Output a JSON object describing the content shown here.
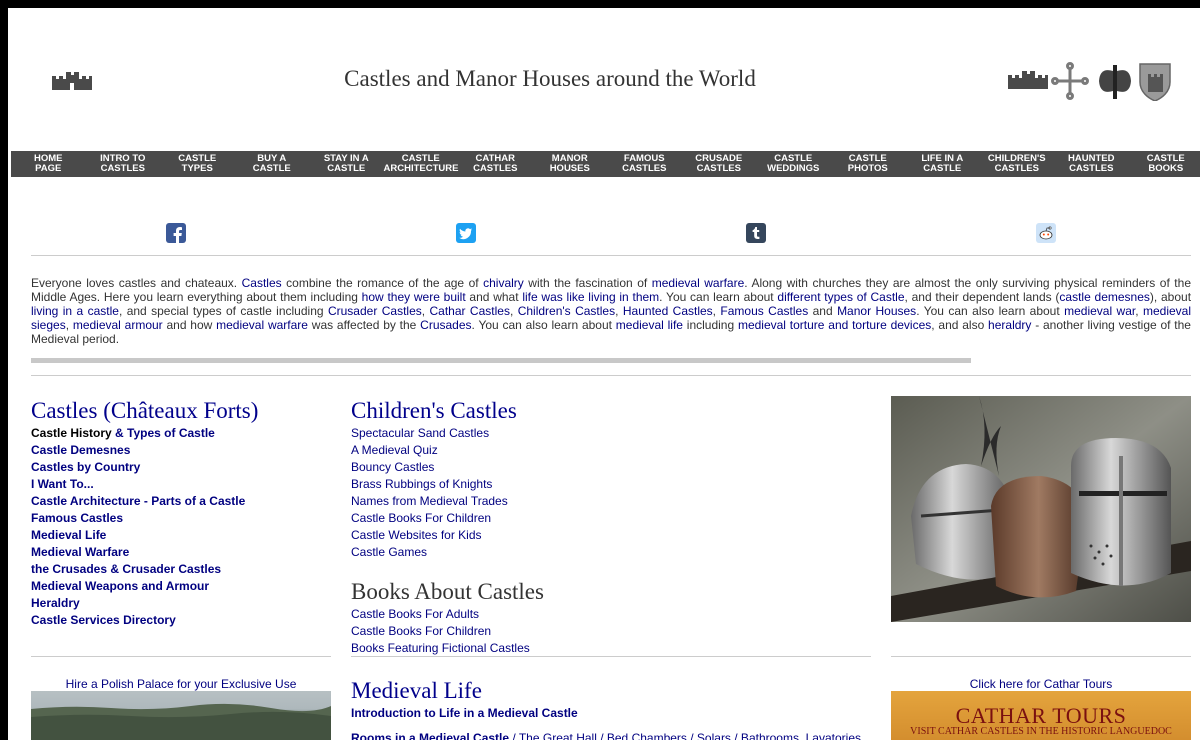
{
  "header": {
    "title": "Castles and Manor Houses around the World",
    "left_icon": "castle-silhouette-icon",
    "right_icons": [
      "castle-silhouette-icon",
      "occitan-cross-icon",
      "battle-axe-icon",
      "castle-shield-icon"
    ]
  },
  "nav": [
    {
      "l1": "Home",
      "l2": "Page"
    },
    {
      "l1": "Intro to",
      "l2": "Castles"
    },
    {
      "l1": "Castle",
      "l2": "Types"
    },
    {
      "l1": "Buy a",
      "l2": "Castle"
    },
    {
      "l1": "Stay in a",
      "l2": "Castle"
    },
    {
      "l1": "Castle",
      "l2": "Architecture"
    },
    {
      "l1": "Cathar",
      "l2": "Castles"
    },
    {
      "l1": "Manor",
      "l2": "Houses"
    },
    {
      "l1": "Famous",
      "l2": "Castles"
    },
    {
      "l1": "Crusade",
      "l2": "Castles"
    },
    {
      "l1": "Castle",
      "l2": "Weddings"
    },
    {
      "l1": "Castle",
      "l2": "Photos"
    },
    {
      "l1": "Life in a",
      "l2": "Castle"
    },
    {
      "l1": "Children's",
      "l2": "Castles"
    },
    {
      "l1": "Haunted",
      "l2": "Castles"
    },
    {
      "l1": "Castle",
      "l2": "Books"
    }
  ],
  "social": [
    "facebook-icon",
    "twitter-icon",
    "tumblr-icon",
    "reddit-icon"
  ],
  "intro": {
    "t1": "Everyone loves castles and chateaux. ",
    "l1": "Castles",
    "t2": " combine the romance of the age of ",
    "l2": "chivalry",
    "t3": " with the fascination of ",
    "l3": "medieval warfare",
    "t4": ". Along with churches they are almost the only surviving physical reminders of the Middle Ages. Here you learn everything about them including ",
    "l4": "how they were built",
    "t5": " and what ",
    "l5": "life was like living in them",
    "t6": ". You can learn about ",
    "l6": "different types of Castle",
    "t7": ", and their dependent lands (",
    "l7": "castle demesnes",
    "t8": "), about ",
    "l8": "living in a castle",
    "t9": ", and special types of castle including ",
    "l9": "Crusader Castles",
    "t10": ", ",
    "l10": "Cathar Castles",
    "t11": ", ",
    "l11": "Children's Castles",
    "t12": ", ",
    "l12": "Haunted Castles",
    "t13": ", ",
    "l13": "Famous Castles",
    "t14": " and ",
    "l14": "Manor Houses",
    "t15": ". You can also learn about ",
    "l15": "medieval war",
    "t16": ", ",
    "l16": "medieval sieges",
    "t17": ", ",
    "l17": "medieval armour",
    "t18": " and how ",
    "l18": "medieval warfare",
    "t19": " was affected by the ",
    "l19": "Crusades",
    "t20": ". You can also learn about ",
    "l20": "medieval life",
    "t21": " including ",
    "l21": "medieval torture and torture devices",
    "t22": ", and also ",
    "l22": "heraldry",
    "t23": " - another living vestige of the Medieval period."
  },
  "castles": {
    "heading": "Castles (Châteaux Forts)",
    "first_bold": "Castle History",
    "first_rest": " & Types of Castle",
    "items": [
      "Castle Demesnes",
      "Castles by Country",
      "I Want To...",
      "Castle Architecture - Parts of a Castle",
      "Famous Castles",
      "Medieval Life",
      "Medieval Warfare",
      "the Crusades & Crusader Castles",
      "Medieval Weapons and Armour",
      "Heraldry",
      "Castle Services Directory"
    ]
  },
  "childrens": {
    "heading": "Children's Castles",
    "items": [
      "Spectacular Sand Castles",
      "A Medieval Quiz",
      "Bouncy Castles",
      "Brass Rubbings of Knights",
      "Names from Medieval Trades",
      "Castle Books For Children",
      "Castle Websites for Kids",
      "Castle Games"
    ]
  },
  "books": {
    "heading": "Books About Castles",
    "items": [
      "Castle Books For Adults",
      "Castle Books For Children",
      "Books Featuring Fictional Castles"
    ]
  },
  "medieval": {
    "heading": "Medieval Life",
    "intro_link": "Introduction to Life in a Medieval Castle",
    "sub_bold": "Rooms in a Medieval Castle",
    "sub_rest": " / The Great Hall / Bed Chambers / Solars / Bathrooms, Lavatories"
  },
  "ads": {
    "palace_caption": "Hire a Polish Palace for your Exclusive Use",
    "cathar_caption": "Click here for Cathar Tours",
    "cathar_title": "Cathar Tours",
    "cathar_sub": "Visit Cathar Castles in the Historic Languedoc"
  },
  "colors": {
    "nav_bg": "#4a4a4a",
    "link": "#000080",
    "heading": "#00008b"
  }
}
